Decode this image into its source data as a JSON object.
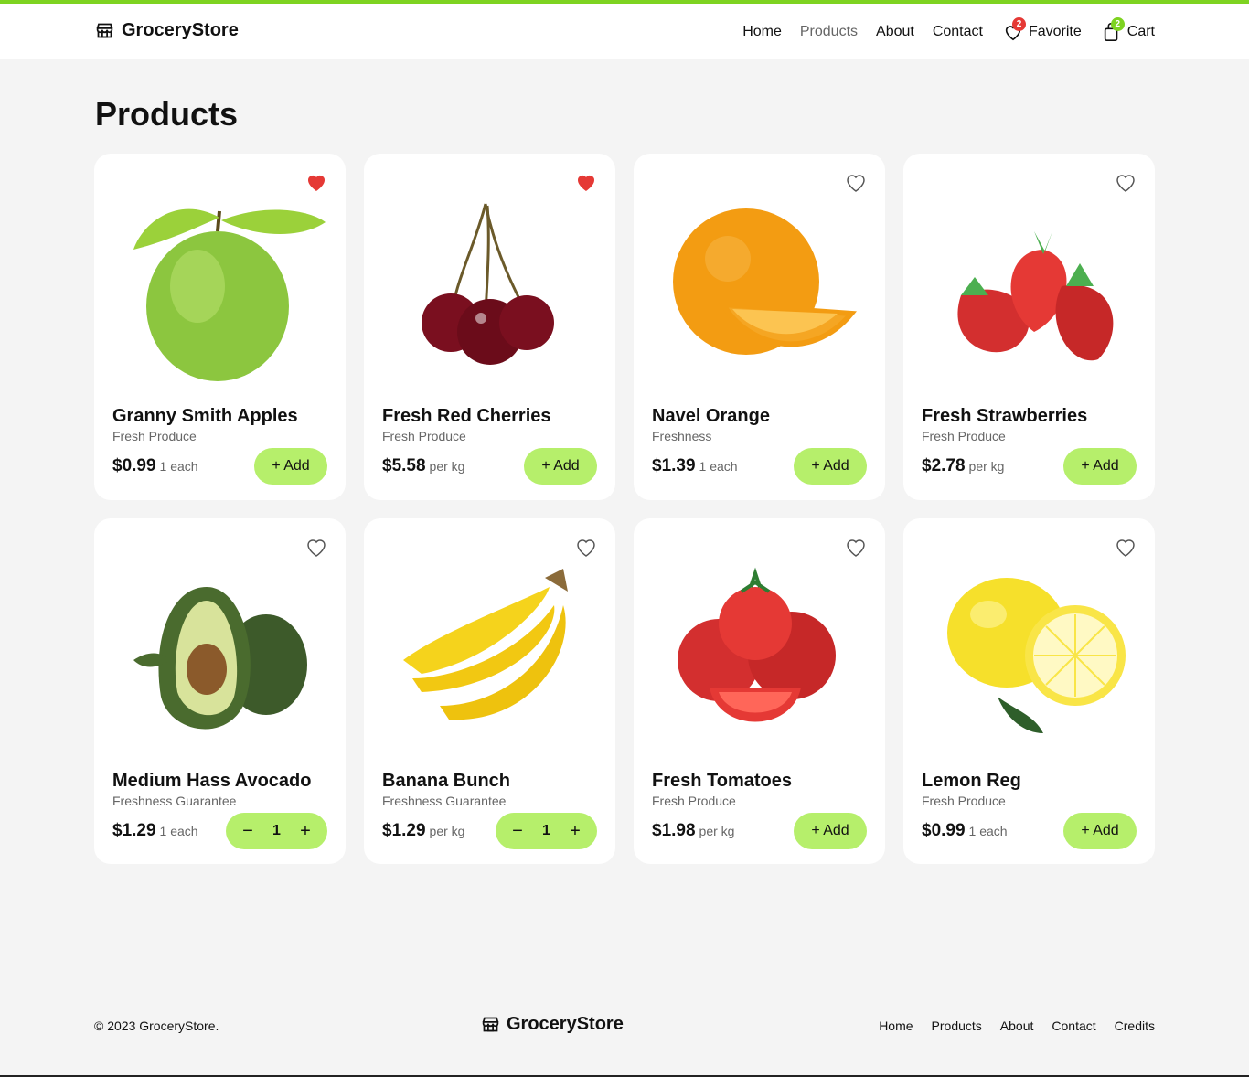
{
  "header": {
    "brand": "GroceryStore",
    "nav": {
      "home": "Home",
      "products": "Products",
      "about": "About",
      "contact": "Contact",
      "favorite": "Favorite",
      "favorite_count": "2",
      "cart": "Cart",
      "cart_count": "2"
    }
  },
  "page": {
    "title": "Products"
  },
  "products": [
    {
      "name": "Granny Smith Apples",
      "category": "Fresh Produce",
      "price": "$0.99",
      "unit": "1 each",
      "favorite": true,
      "action": "+ Add",
      "icon": "green-apple"
    },
    {
      "name": "Fresh Red Cherries",
      "category": "Fresh Produce",
      "price": "$5.58",
      "unit": "per kg",
      "favorite": true,
      "action": "+ Add",
      "icon": "cherries"
    },
    {
      "name": "Navel Orange",
      "category": "Freshness",
      "price": "$1.39",
      "unit": "1 each",
      "favorite": false,
      "action": "+ Add",
      "icon": "orange"
    },
    {
      "name": "Fresh Strawberries",
      "category": "Fresh Produce",
      "price": "$2.78",
      "unit": "per kg",
      "favorite": false,
      "action": "+ Add",
      "icon": "strawberries"
    },
    {
      "name": "Medium Hass Avocado",
      "category": "Freshness Guarantee",
      "price": "$1.29",
      "unit": "1 each",
      "favorite": false,
      "quantity": "1",
      "icon": "avocado"
    },
    {
      "name": "Banana Bunch",
      "category": "Freshness Guarantee",
      "price": "$1.29",
      "unit": "per kg",
      "favorite": false,
      "quantity": "1",
      "icon": "bananas"
    },
    {
      "name": "Fresh Tomatoes",
      "category": "Fresh Produce",
      "price": "$1.98",
      "unit": "per kg",
      "favorite": false,
      "action": "+ Add",
      "icon": "tomatoes"
    },
    {
      "name": "Lemon Reg",
      "category": "Fresh Produce",
      "price": "$0.99",
      "unit": "1 each",
      "favorite": false,
      "action": "+ Add",
      "icon": "lemon"
    }
  ],
  "stepper": {
    "minus": "−",
    "plus": "+"
  },
  "footer": {
    "copyright": "© 2023 GroceryStore.",
    "brand": "GroceryStore",
    "links": {
      "home": "Home",
      "products": "Products",
      "about": "About",
      "contact": "Contact",
      "credits": "Credits"
    }
  },
  "colors": {
    "accent": "#7ed321",
    "button": "#b6ef6b",
    "heart": "#e53935",
    "background": "#f4f4f4"
  }
}
